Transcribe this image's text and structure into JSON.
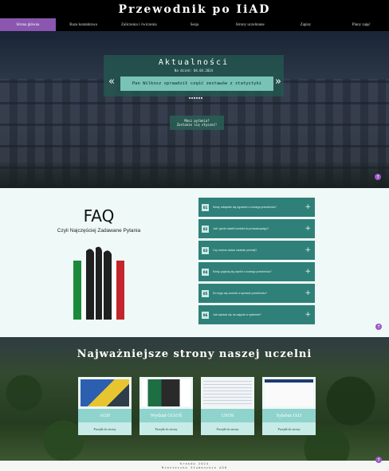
{
  "header": {
    "title": "Przewodnik po IiAD"
  },
  "nav": {
    "items": [
      "Strona główna",
      "Baza kontaktowa",
      "Zaliczenia i ćwiczenia",
      "Sesja",
      "Strony uczelniane",
      "Zapisy",
      "Plany zajęć"
    ]
  },
  "hero": {
    "news_title": "Aktualności",
    "news_date": "Na dzień: 04.04.2024",
    "news_item": "Pan Wilkosz sprawdził część zestawów z statystyki",
    "prev_icon": "chevron-double-left-icon",
    "next_icon": "chevron-double-right-icon",
    "contact_line1": "Masz pytania?",
    "contact_line2": "Zostanie się słyszeć!"
  },
  "faq": {
    "title": "FAQ",
    "subtitle": "Czyli Najczęściej Zadawane Pytania",
    "items": [
      {
        "num": "01",
        "question": "Kiedy odbędzie się egzamin z nowego przedmiotu?"
      },
      {
        "num": "02",
        "question": "Jak i gdzie ustalić kontakt do prowadzącego?"
      },
      {
        "num": "03",
        "question": "Czy można oddać zadanie później?"
      },
      {
        "num": "04",
        "question": "Kiedy pojawią się wyniki z nowego przedmiotu?"
      },
      {
        "num": "05",
        "question": "Do kogo się zwrócić w sprawie przedmiotu?"
      },
      {
        "num": "06",
        "question": "Jak zapisać się na zajęcia w systemie?"
      }
    ]
  },
  "pages": {
    "title": "Najważniejsze strony naszej uczelni",
    "cards": [
      {
        "name": "AGH",
        "link": "Przejdź do strony"
      },
      {
        "name": "Wydział GGiOŚ",
        "link": "Przejdź do strony"
      },
      {
        "name": "USOS",
        "link": "Przejdź do strony"
      },
      {
        "name": "Sylabus IAD",
        "link": "Przejdź do strony"
      }
    ]
  },
  "footer": {
    "line1": "Kraków 2024",
    "line2": "Miasteczko Studenckie AGH"
  },
  "colors": {
    "accent": "#8a56b0",
    "teal": "#2f8079",
    "scroll": "#9c59c4"
  }
}
